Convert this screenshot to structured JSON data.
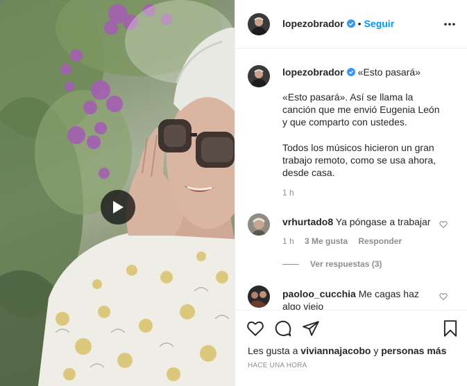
{
  "post": {
    "author": "lopezobrador",
    "follow_label": "Seguir",
    "separator": "•",
    "caption_title": "«Esto pasará»",
    "caption_paragraph_1": "«Esto pasará». Así se llama la canción que me envió Eugenia León y que comparto con ustedes.",
    "caption_paragraph_2": "Todos los músicos hicieron un gran trabajo remoto, como se usa ahora, desde casa.",
    "caption_time": "1 h"
  },
  "comments": [
    {
      "user": "vrhurtado8",
      "text": "Ya póngase a trabajar",
      "time": "1 h",
      "likes": "3 Me gusta",
      "reply_label": "Responder",
      "view_replies": "Ver respuestas (3)"
    },
    {
      "user": "paoloo_cucchia",
      "text": "Me cagas haz algo viejo"
    }
  ],
  "footer": {
    "likes_prefix": "Les gusta a",
    "liked_by_user": "viviannajacobo",
    "likes_connector": "y",
    "likes_others": "personas más",
    "date": "HACE UNA HORA"
  },
  "icons": {
    "verified": "verified-badge-icon",
    "more": "more-options-icon",
    "play": "play-icon",
    "like": "heart-icon",
    "comment": "comment-icon",
    "share": "paper-plane-icon",
    "save": "bookmark-icon"
  },
  "colors": {
    "accent": "#0095f6",
    "text": "#262626",
    "muted": "#8e8e8e",
    "border": "#efefef"
  }
}
